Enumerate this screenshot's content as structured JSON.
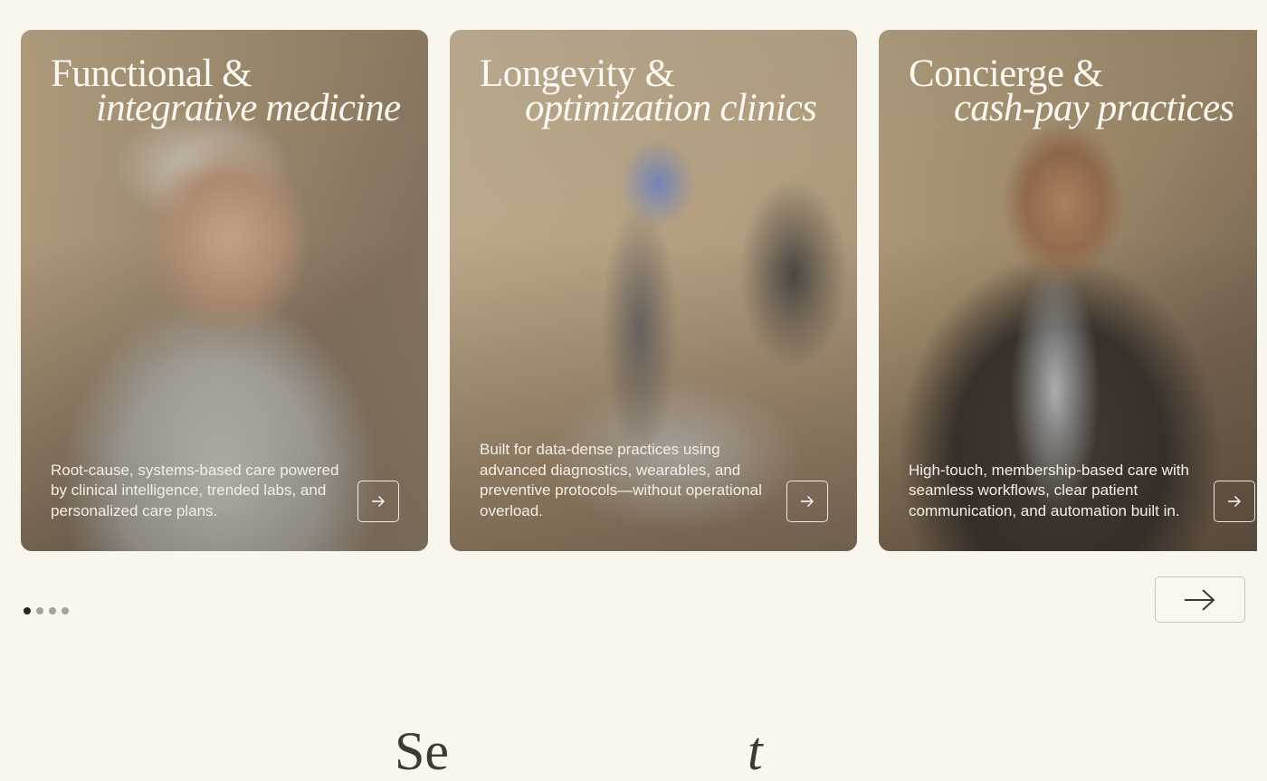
{
  "cards": [
    {
      "title_line1": "Functional &",
      "title_line2": "integrative medicine",
      "description": "Root-cause, systems-based care powered by clinical intelligence, trended labs, and personalized care plans.",
      "arrow_icon": "arrow-right-icon"
    },
    {
      "title_line1": "Longevity &",
      "title_line2": "optimization clinics",
      "description": "Built for data-dense practices using advanced diagnostics, wearables, and preventive protocols—without operational overload.",
      "arrow_icon": "arrow-right-icon"
    },
    {
      "title_line1": "Concierge &",
      "title_line2": "cash-pay practices",
      "description": "High-touch, membership-based care with seamless workflows, clear patient communication, and automation built in.",
      "arrow_icon": "arrow-right-icon"
    }
  ],
  "pagination": {
    "total": 4,
    "active": 1
  },
  "next_button": {
    "icon": "arrow-right-icon"
  },
  "bottom_heading": {
    "part1": "Se",
    "part2": "t"
  },
  "colors": {
    "background": "#f9f6ee",
    "dot_active": "#2a2723",
    "dot_inactive": "#a8a39b"
  }
}
